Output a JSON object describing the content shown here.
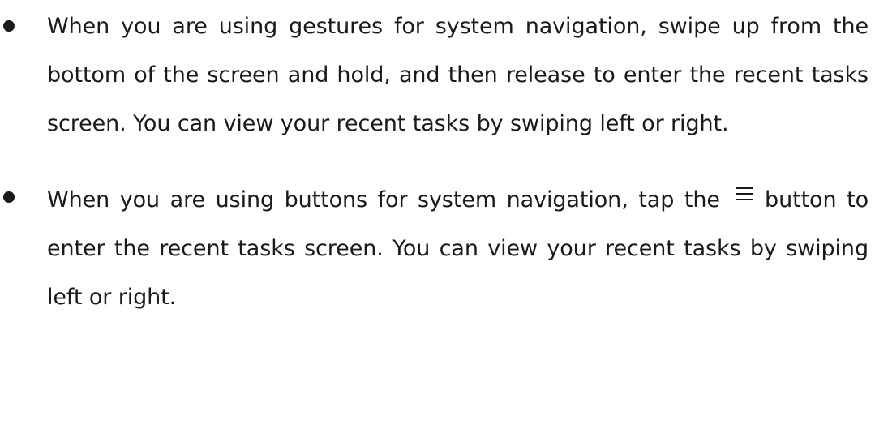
{
  "items": [
    {
      "text": "When you are using gestures for system navigation, swipe up from the bottom of the screen and hold, and then release to enter the recent tasks screen. You can view your recent tasks by swiping left or right."
    },
    {
      "text_before": "When you are using buttons for system navigation, tap the",
      "icon": "recent-tasks-icon",
      "text_after": "button to enter the recent tasks screen. You can view your recent tasks by swiping left or right."
    }
  ]
}
